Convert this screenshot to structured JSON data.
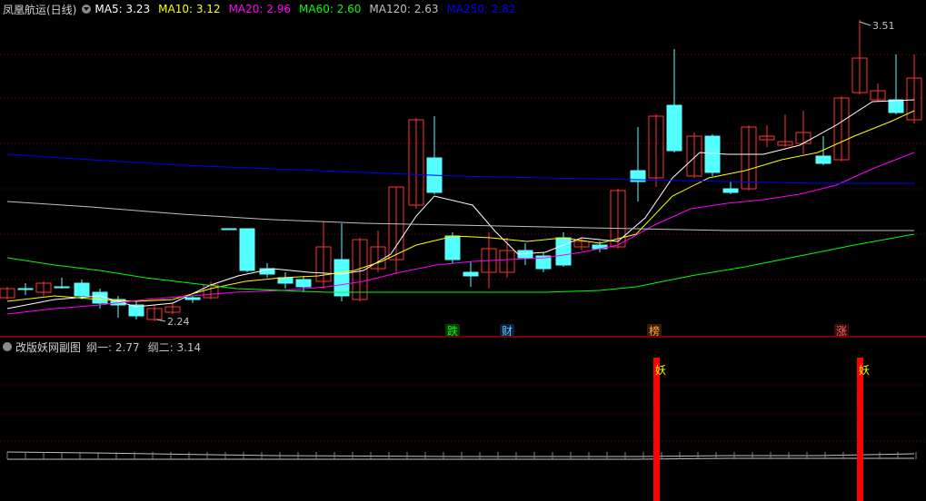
{
  "main_chart": {
    "title": "凤凰航运(日线)",
    "indicators": [
      {
        "label": "MA5:",
        "value": "3.23",
        "color": "#ffffff"
      },
      {
        "label": "MA10:",
        "value": "3.12",
        "color": "#ffff00"
      },
      {
        "label": "MA20:",
        "value": "2.96",
        "color": "#ff00ff"
      },
      {
        "label": "MA60:",
        "value": "2.60",
        "color": "#00ff00"
      },
      {
        "label": "MA120:",
        "value": "2.63",
        "color": "#c0c0c0"
      },
      {
        "label": "MA250:",
        "value": "2.82",
        "color": "#0000ff"
      }
    ],
    "high_marker": "3.51",
    "low_marker": "2.24",
    "event_labels": [
      {
        "text": "跌",
        "color": "#00ff00",
        "bg": "#0a3a0a"
      },
      {
        "text": "财",
        "color": "#66ccff",
        "bg": "#0a1f3a"
      },
      {
        "text": "榜",
        "color": "#ffaa33",
        "bg": "#3a1a0a"
      },
      {
        "text": "涨",
        "color": "#ff6666",
        "bg": "#3a0a0a"
      }
    ]
  },
  "sub_chart": {
    "title": "改版妖网副图",
    "indicators": [
      {
        "label": "纲一:",
        "value": "2.77",
        "color": "#c0c0c0"
      },
      {
        "label": "纲二:",
        "value": "3.14",
        "color": "#c0c0c0"
      }
    ],
    "signal_label": "妖"
  },
  "colors": {
    "up": "#ff3232",
    "down": "#54ffff",
    "grid": "#800000",
    "background": "#000000"
  }
}
